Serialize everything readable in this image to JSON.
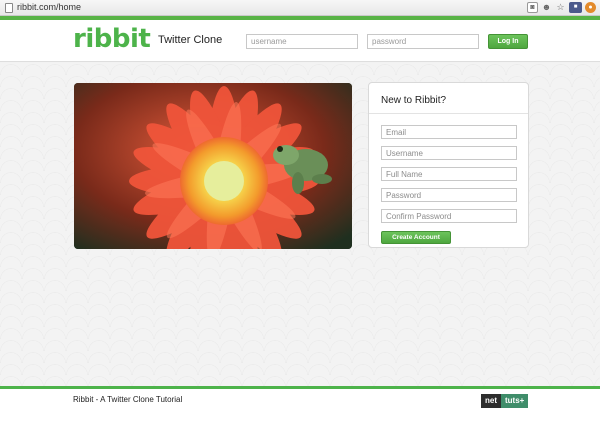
{
  "browser": {
    "url": "ribbit.com/home",
    "icons": [
      "page-icon",
      "rss-icon",
      "person-icon",
      "star-icon",
      "ext-icon",
      "cookie-icon"
    ]
  },
  "header": {
    "logo": "ribbit",
    "tagline": "Twitter Clone",
    "username_placeholder": "username",
    "password_placeholder": "password",
    "login_label": "Log In"
  },
  "signup": {
    "title": "New to Ribbit?",
    "fields": {
      "email": "Email",
      "username": "Username",
      "full_name": "Full Name",
      "password": "Password",
      "confirm_password": "Confirm Password"
    },
    "create_label": "Create Account"
  },
  "footer": {
    "text": "Ribbit - A Twitter Clone Tutorial",
    "badge_net": "net",
    "badge_tuts": "tuts+"
  },
  "colors": {
    "brand_green": "#4db34a",
    "footer_badge": "#3f8d6a"
  }
}
